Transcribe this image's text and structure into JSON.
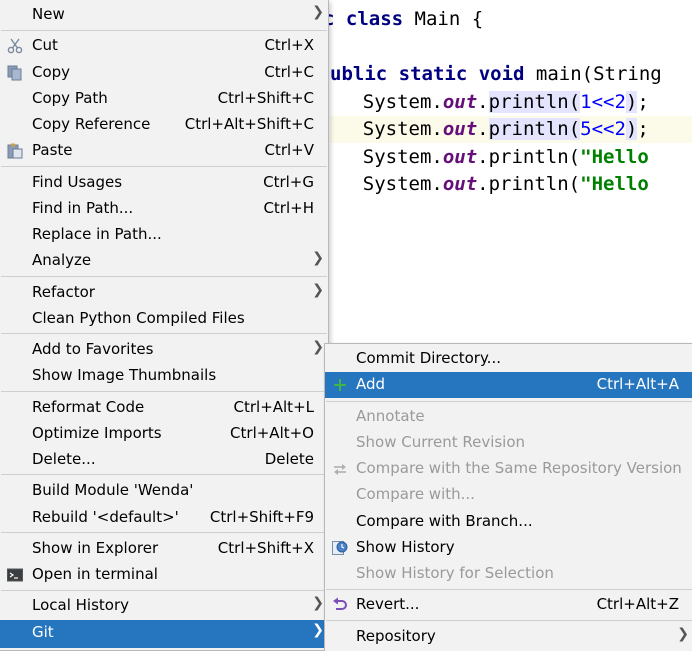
{
  "editor": {
    "lines": [
      {
        "parts": [
          {
            "t": "c ",
            "c": "kw"
          },
          {
            "t": "class",
            "c": "kw"
          },
          {
            "t": " Main {",
            "c": ""
          }
        ]
      },
      {
        "parts": [
          {
            "t": "ublic static void",
            "c": "kw"
          },
          {
            "t": " main(String",
            "c": ""
          }
        ]
      },
      {
        "parts": [
          {
            "t": "    System.",
            "c": ""
          },
          {
            "t": "out",
            "c": "fld"
          },
          {
            "t": ".",
            "c": ""
          },
          {
            "t": "println(",
            "c": "mhl"
          },
          {
            "t": "1<<2",
            "c": "num"
          },
          {
            "t": ")",
            "c": "mhl"
          },
          {
            "t": ";",
            "c": ""
          }
        ]
      },
      {
        "parts": [
          {
            "t": "    System.",
            "c": ""
          },
          {
            "t": "out",
            "c": "fld"
          },
          {
            "t": ".",
            "c": ""
          },
          {
            "t": "println(",
            "c": "mhl"
          },
          {
            "t": "5<<2",
            "c": "num"
          },
          {
            "t": ")",
            "c": "mhl"
          },
          {
            "t": ";",
            "c": ""
          }
        ]
      },
      {
        "parts": [
          {
            "t": "    System.",
            "c": ""
          },
          {
            "t": "out",
            "c": "fld"
          },
          {
            "t": ".println(",
            "c": ""
          },
          {
            "t": "\"Hello",
            "c": "str"
          }
        ]
      },
      {
        "parts": [
          {
            "t": "    System.",
            "c": ""
          },
          {
            "t": "out",
            "c": "fld"
          },
          {
            "t": ".println(",
            "c": ""
          },
          {
            "t": "\"Hello",
            "c": "str"
          }
        ]
      }
    ]
  },
  "main_menu": {
    "items": [
      {
        "label": "New",
        "shortcut": "",
        "submenu": true
      },
      {
        "label": "Cut",
        "shortcut": "Ctrl+X",
        "icon": "scissors-icon"
      },
      {
        "label": "Copy",
        "shortcut": "Ctrl+C",
        "icon": "copy-icon"
      },
      {
        "label": "Copy Path",
        "shortcut": "Ctrl+Shift+C"
      },
      {
        "label": "Copy Reference",
        "shortcut": "Ctrl+Alt+Shift+C"
      },
      {
        "label": "Paste",
        "shortcut": "Ctrl+V",
        "icon": "paste-icon"
      },
      {
        "label": "Find Usages",
        "shortcut": "Ctrl+G"
      },
      {
        "label": "Find in Path...",
        "shortcut": "Ctrl+H"
      },
      {
        "label": "Replace in Path...",
        "shortcut": ""
      },
      {
        "label": "Analyze",
        "shortcut": "",
        "submenu": true
      },
      {
        "label": "Refactor",
        "shortcut": "",
        "submenu": true
      },
      {
        "label": "Clean Python Compiled Files",
        "shortcut": ""
      },
      {
        "label": "Add to Favorites",
        "shortcut": "",
        "submenu": true
      },
      {
        "label": "Show Image Thumbnails",
        "shortcut": ""
      },
      {
        "label": "Reformat Code",
        "shortcut": "Ctrl+Alt+L"
      },
      {
        "label": "Optimize Imports",
        "shortcut": "Ctrl+Alt+O"
      },
      {
        "label": "Delete...",
        "shortcut": "Delete"
      },
      {
        "label": "Build Module 'Wenda'",
        "shortcut": ""
      },
      {
        "label": "Rebuild '<default>'",
        "shortcut": "Ctrl+Shift+F9"
      },
      {
        "label": "Show in Explorer",
        "shortcut": "Ctrl+Shift+X"
      },
      {
        "label": "Open in terminal",
        "shortcut": "",
        "icon": "terminal-icon"
      },
      {
        "label": "Local History",
        "shortcut": "",
        "submenu": true
      },
      {
        "label": "Git",
        "shortcut": "",
        "submenu": true,
        "selected": true
      }
    ]
  },
  "git_menu": {
    "items": [
      {
        "label": "Commit Directory...",
        "shortcut": ""
      },
      {
        "label": "Add",
        "shortcut": "Ctrl+Alt+A",
        "icon": "plus-icon",
        "selected": true
      },
      {
        "label": "Annotate",
        "shortcut": "",
        "disabled": true
      },
      {
        "label": "Show Current Revision",
        "shortcut": "",
        "disabled": true
      },
      {
        "label": "Compare with the Same Repository Version",
        "shortcut": "",
        "disabled": true,
        "icon": "compare-icon"
      },
      {
        "label": "Compare with...",
        "shortcut": "",
        "disabled": true
      },
      {
        "label": "Compare with Branch...",
        "shortcut": ""
      },
      {
        "label": "Show History",
        "shortcut": "",
        "icon": "history-icon"
      },
      {
        "label": "Show History for Selection",
        "shortcut": "",
        "disabled": true
      },
      {
        "label": "Revert...",
        "shortcut": "Ctrl+Alt+Z",
        "icon": "revert-icon"
      },
      {
        "label": "Repository",
        "shortcut": "",
        "submenu": true
      }
    ]
  },
  "colors": {
    "selection": "#2675bf",
    "menu_bg": "#f2f2f2",
    "disabled_text": "#9a9a9a"
  }
}
